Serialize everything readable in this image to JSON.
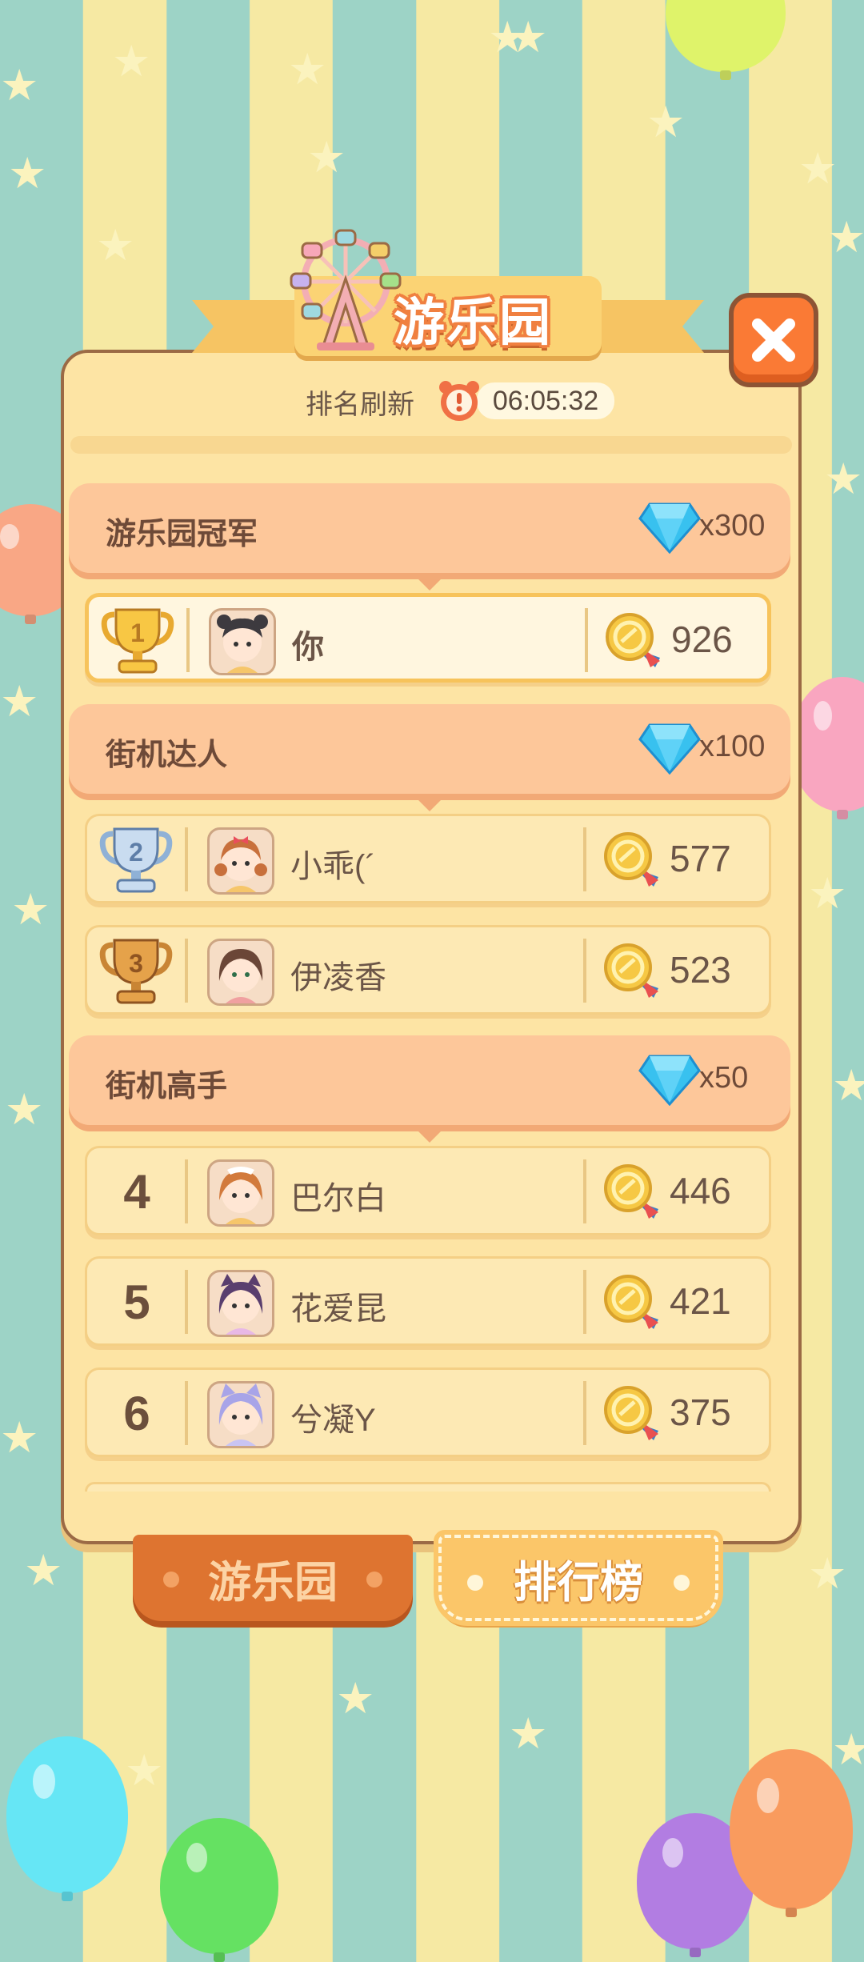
{
  "app": {
    "title": "游乐园"
  },
  "refresh": {
    "label": "排名刷新",
    "timer": "06:05:32"
  },
  "tiers": [
    {
      "title": "游乐园冠军",
      "reward": "x300"
    },
    {
      "title": "街机达人",
      "reward": "x100"
    },
    {
      "title": "街机高手",
      "reward": "x50"
    }
  ],
  "rows": [
    {
      "rank": "1",
      "name": "你",
      "score": "926",
      "trophy": "gold-trophy"
    },
    {
      "rank": "2",
      "name": "小乖(´",
      "score": "577",
      "trophy": "silver-trophy"
    },
    {
      "rank": "3",
      "name": "伊凌香",
      "score": "523",
      "trophy": "bronze-trophy"
    },
    {
      "rank": "4",
      "name": "巴尔白",
      "score": "446"
    },
    {
      "rank": "5",
      "name": "花爱昆",
      "score": "421"
    },
    {
      "rank": "6",
      "name": "兮凝Y",
      "score": "375"
    }
  ],
  "tabs": [
    {
      "label": "游乐园",
      "active": false
    },
    {
      "label": "排行榜",
      "active": true
    }
  ],
  "colors": {
    "accent": "#fa7a35",
    "panel": "#fde4a4",
    "tier_header": "#fdc79a",
    "gold": "#f7c35b"
  }
}
